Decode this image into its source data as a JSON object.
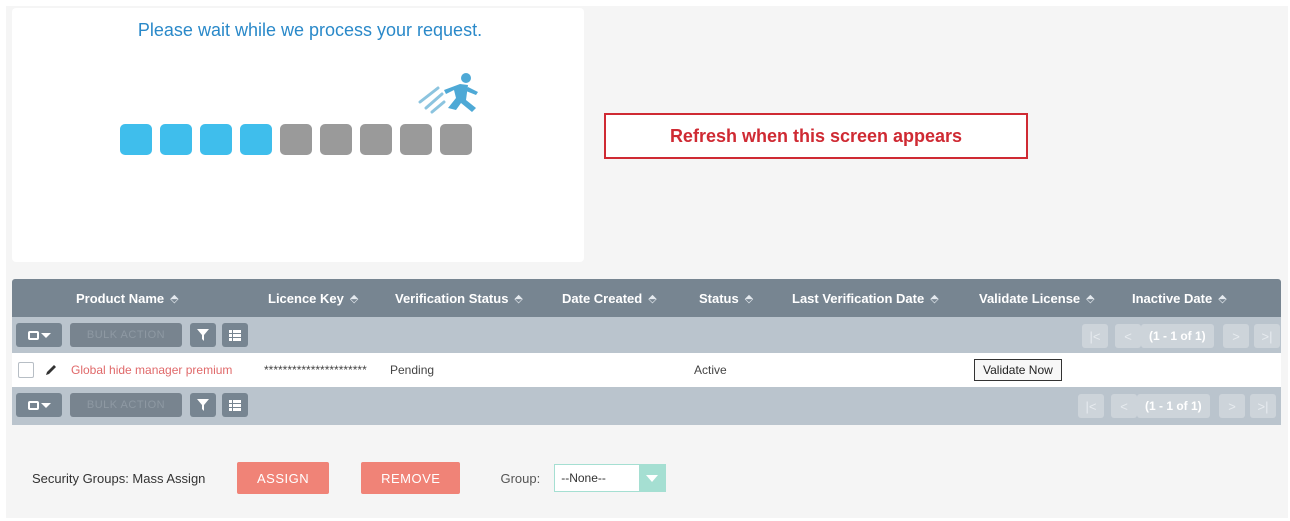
{
  "loading": {
    "message": "Please wait while we process your request.",
    "progress_blocks": {
      "total": 9,
      "filled": 4
    },
    "colors": {
      "filled": "#3fbeec",
      "empty": "#9a9a9a"
    }
  },
  "annotation": {
    "text": "Refresh when this screen appears",
    "color": "#cf2a33"
  },
  "table": {
    "columns": [
      "Product Name",
      "Licence Key",
      "Verification Status",
      "Date Created",
      "Status",
      "Last Verification Date",
      "Validate License",
      "Inactive Date"
    ],
    "bulk_action_label": "BULK ACTION",
    "pagination": "(1 - 1 of 1)",
    "rows": [
      {
        "product_name": "Global hide manager premium",
        "licence_key": "**********************",
        "verification_status": "Pending",
        "date_created": "",
        "status": "Active",
        "last_verification_date": "",
        "validate_label": "Validate Now",
        "inactive_date": ""
      }
    ]
  },
  "security_groups": {
    "label": "Security Groups: Mass Assign",
    "assign_label": "ASSIGN",
    "remove_label": "REMOVE",
    "group_label": "Group:",
    "group_value": "--None--"
  },
  "icons": [
    "runner-icon",
    "caret-down-icon",
    "filter-icon",
    "list-columns-icon",
    "first-page-icon",
    "prev-page-icon",
    "next-page-icon",
    "last-page-icon",
    "pencil-icon",
    "sort-icon"
  ]
}
